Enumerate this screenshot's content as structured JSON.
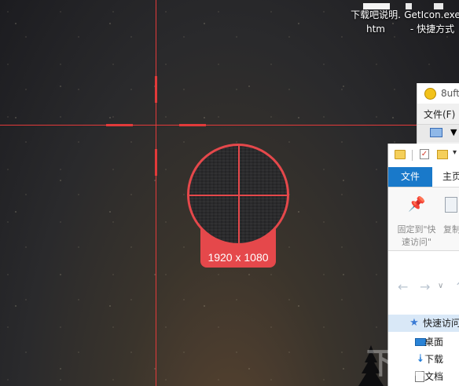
{
  "desktop": {
    "icons": [
      {
        "label_line1": "下载吧说明.",
        "label_line2": "htm"
      },
      {
        "label_line1": "GetIcon.exe",
        "label_line2": "- 快捷方式"
      }
    ]
  },
  "magnifier": {
    "resolution_label": "1920 x 1080",
    "accent_color": "#e5484b"
  },
  "crosshair_color": "#e23a3a",
  "background_window": {
    "title": "8uft",
    "menu_file": "文件(F)",
    "dropdown_arrow": "▼"
  },
  "explorer": {
    "quick_access_dropdown": "▾",
    "tabs": [
      {
        "label": "文件",
        "active": true
      },
      {
        "label": "主页",
        "active": false
      }
    ],
    "ribbon": {
      "pin_label": "固定到\"快速访问\"",
      "copy_label": "复制"
    },
    "nav": {
      "back": "←",
      "forward": "→",
      "recent": "∨",
      "up": "↑"
    },
    "nav_pane": [
      {
        "label": "快速访问",
        "icon": "star-icon",
        "glyph": "★",
        "selected": true
      },
      {
        "label": "桌面",
        "icon": "desktop-icon",
        "glyph": "",
        "selected": false
      },
      {
        "label": "下载",
        "icon": "download-icon",
        "glyph": "↓",
        "selected": false
      },
      {
        "label": "文档",
        "icon": "document-icon",
        "glyph": "",
        "selected": false
      }
    ],
    "tab_accent_color": "#1979ca"
  },
  "watermark_text": "下载"
}
